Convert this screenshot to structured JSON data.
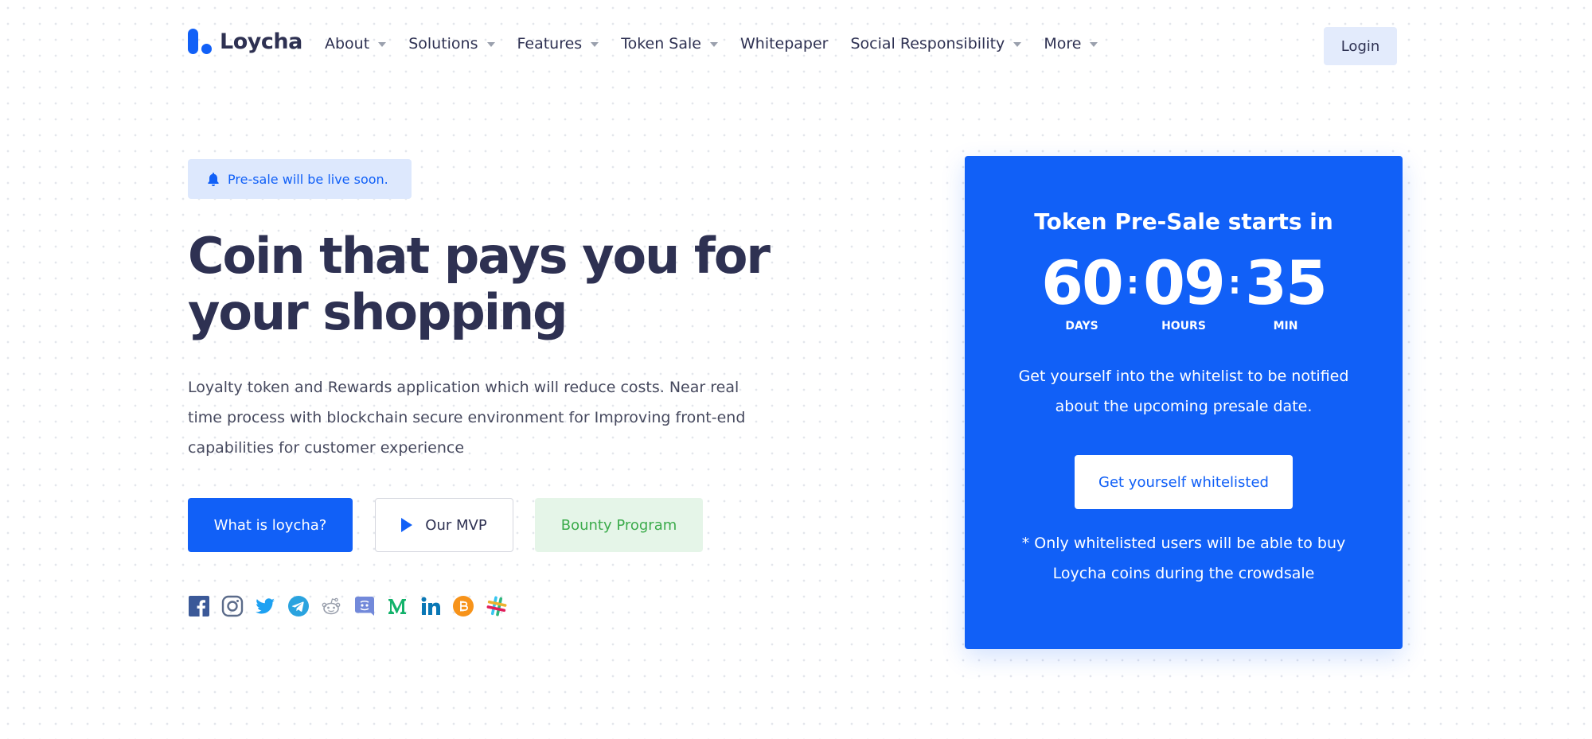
{
  "brand": {
    "name": "Loycha",
    "color": "#1160f7"
  },
  "nav": {
    "items": [
      {
        "label": "About",
        "has_dropdown": true
      },
      {
        "label": "Solutions",
        "has_dropdown": true
      },
      {
        "label": "Features",
        "has_dropdown": true
      },
      {
        "label": "Token Sale",
        "has_dropdown": true
      },
      {
        "label": "Whitepaper",
        "has_dropdown": false
      },
      {
        "label": "Social Responsibility",
        "has_dropdown": true
      },
      {
        "label": "More",
        "has_dropdown": true
      }
    ],
    "login_label": "Login"
  },
  "hero": {
    "badge": "Pre-sale will be live soon.",
    "headline_line1": "Coin that pays you for",
    "headline_line2": "your shopping",
    "description": "Loyalty token and Rewards application which will reduce costs. Near real time process with blockchain secure environment for Improving front-end capabilities for customer experience",
    "buttons": {
      "primary": "What is loycha?",
      "mvp": "Our MVP",
      "bounty": "Bounty Program"
    },
    "socials": [
      "facebook-icon",
      "instagram-icon",
      "twitter-icon",
      "telegram-icon",
      "reddit-icon",
      "discord-icon",
      "medium-icon",
      "linkedin-icon",
      "bitcoin-icon",
      "slack-icon"
    ]
  },
  "presale": {
    "title": "Token Pre-Sale starts in",
    "countdown": {
      "days": "60",
      "days_label": "DAYS",
      "hours": "09",
      "hours_label": "HOURS",
      "minutes": "35",
      "minutes_label": "MIN",
      "separator": ":"
    },
    "text": "Get yourself into the whitelist to be notified about the upcoming presale date.",
    "button": "Get yourself whitelisted",
    "note": "* Only whitelisted users will be able to buy Loycha coins during the crowdsale"
  },
  "colors": {
    "primary": "#1160f7",
    "text_dark": "#2e3152",
    "bounty_green": "#3bab4b",
    "badge_bg": "#dde8fd"
  }
}
